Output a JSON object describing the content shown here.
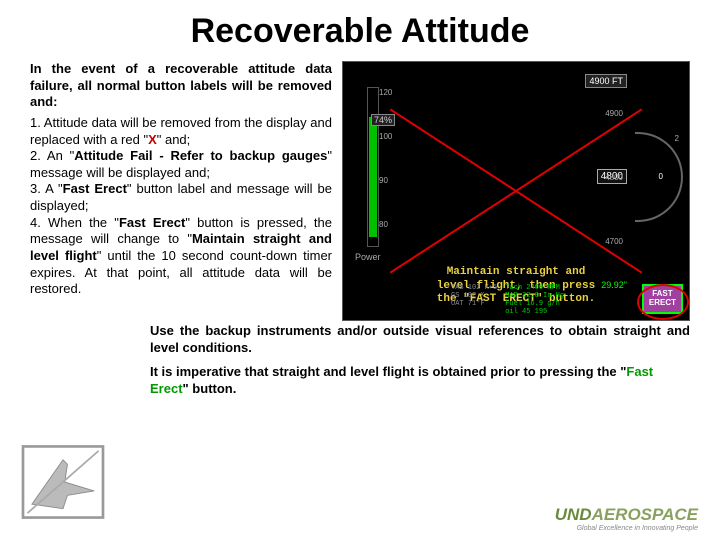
{
  "title": "Recoverable Attitude",
  "intro": "In the event of a recoverable attitude data failure, all normal button labels will be removed and:",
  "items": {
    "i1a": "1.  Attitude data will be removed from the display and replaced with a red \"",
    "i1x": "X",
    "i1b": "\" and;",
    "i2a": "2.  An \"",
    "i2b": "Attitude Fail - Refer to backup gauges",
    "i2c": "\" message will be displayed and;",
    "i3a": "3.  A \"",
    "i3b": "Fast Erect",
    "i3c": "\" button label and message will be displayed;",
    "i4a": "4.  When the \"",
    "i4b": "Fast Erect",
    "i4c": "\" button is pressed, the message will change to \"",
    "i4d": "Maintain straight and level flight",
    "i4e": "\" until the 10 second count-down timer expires. At that point, all attitude data will be restored."
  },
  "footer1": "Use the backup instruments and/or outside visual references to obtain straight and level conditions.",
  "footer2a": "It is imperative that straight and level flight is obtained prior to pressing the \"",
  "footer2b": "Fast Erect",
  "footer2c": "\" button.",
  "pfd": {
    "power_pct": "74%",
    "power_label": "Power",
    "power_ticks": "120\n\n100\n\n90\n\n80",
    "alt_top": "4900 FT",
    "alt_center": "4800",
    "alt_ticks": "4900\n\n4800\n\n4700",
    "baro": "29.92\"",
    "vsi_top": "2",
    "vsi_zero": "0",
    "fast_erect": "FAST\nERECT",
    "instr_l1": "Maintain straight and",
    "instr_l2": "level flight, then press",
    "instr_l3": "the \"FAST ERECT\" button.",
    "eng_left": "TAS 102 K+5\nGS 102 K\nOAT 71°F",
    "eng_right": "Tach 2400 RPM\nMAP 32.0 In-Hg\nFuel 16.9 g/h\noil 45 195"
  },
  "logo": {
    "und": "UND",
    "aero": "AEROSPACE",
    "tag": "Global Excellence in Innovating People"
  }
}
